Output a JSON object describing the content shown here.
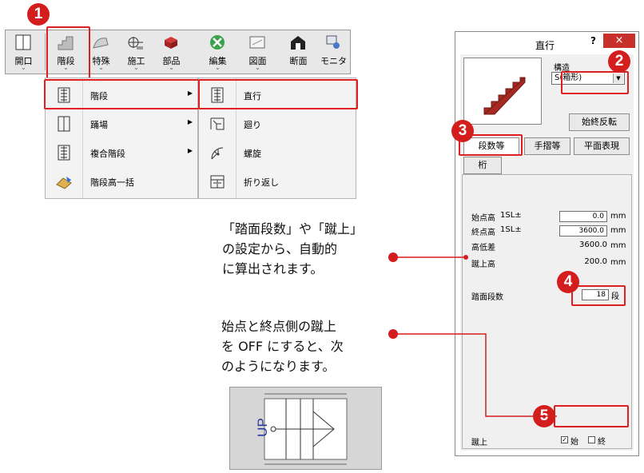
{
  "toolbar": {
    "buttons": [
      {
        "label": "開口",
        "icon": "window-icon"
      },
      {
        "label": "階段",
        "icon": "stairs-icon"
      },
      {
        "label": "特殊",
        "icon": "special-icon"
      },
      {
        "label": "施工",
        "icon": "construction-icon"
      },
      {
        "label": "部品",
        "icon": "parts-icon"
      },
      {
        "label": "編集",
        "icon": "edit-icon"
      },
      {
        "label": "図面",
        "icon": "drawing-icon"
      },
      {
        "label": "断面",
        "icon": "section-icon"
      },
      {
        "label": "モニタ",
        "icon": "monitor-icon"
      }
    ],
    "chevron": "⌄"
  },
  "menu1": {
    "items": [
      {
        "label": "階段",
        "submenu": true
      },
      {
        "label": "踊場",
        "submenu": true
      },
      {
        "label": "複合階段",
        "submenu": true
      },
      {
        "label": "階段高一括",
        "submenu": false
      }
    ]
  },
  "menu2": {
    "items": [
      {
        "label": "直行"
      },
      {
        "label": "廻り"
      },
      {
        "label": "螺旋"
      },
      {
        "label": "折り返し"
      }
    ]
  },
  "steps": [
    "1",
    "2",
    "3",
    "4",
    "5"
  ],
  "dialog": {
    "title": "直行",
    "help": "?",
    "close": "×",
    "structure_label": "構造",
    "structure_value": "S(箱形)",
    "flip_button": "始終反転",
    "tabs": [
      "段数等",
      "手摺等",
      "平面表現",
      "桁"
    ],
    "start_height_label": "始点高",
    "end_height_label": "終点高",
    "level_ref": "1SL±",
    "start_height_value": "0.0",
    "end_height_value": "3600.0",
    "diff_label": "高低差",
    "diff_value": "3600.0",
    "riser_height_label": "蹴上高",
    "riser_height_value": "200.0",
    "unit_mm": "mm",
    "tread_count_label": "踏面段数",
    "tread_count_value": "18",
    "tread_unit": "段",
    "riser_label": "蹴上",
    "riser_start_label": "始",
    "riser_end_label": "終",
    "riser_start_checked": true,
    "riser_end_checked": false
  },
  "annotations": {
    "auto_calc": [
      "「踏面段数」や「蹴上」",
      "の設定から、自動的",
      "に算出されます。"
    ],
    "riser_off": [
      "始点と終点側の蹴上",
      "を OFF にすると、次",
      "のようになります。"
    ]
  },
  "plan_image": {
    "up_label": "UP"
  },
  "colors": {
    "accent_red": "#e02020",
    "badge_red": "#d41e1e",
    "close_red": "#c8302c"
  }
}
